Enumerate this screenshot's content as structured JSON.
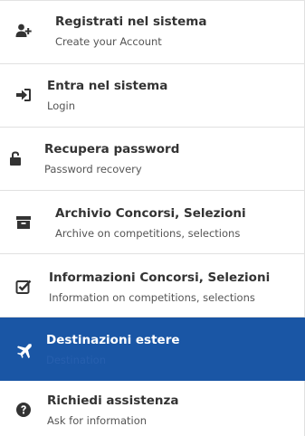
{
  "menu": {
    "items": [
      {
        "title": "Registrati nel sistema",
        "subtitle": "Create your Account",
        "icon": "user-plus-icon",
        "active": false
      },
      {
        "title": "Entra nel sistema",
        "subtitle": "Login",
        "icon": "sign-in-icon",
        "active": false
      },
      {
        "title": "Recupera password",
        "subtitle": "Password recovery",
        "icon": "unlock-icon",
        "active": false
      },
      {
        "title": "Archivio Concorsi, Selezioni",
        "subtitle": "Archive on competitions, selections",
        "icon": "archive-icon",
        "active": false
      },
      {
        "title": "Informazioni Concorsi, Selezioni",
        "subtitle": "Information on competitions, selections",
        "icon": "check-square-icon",
        "active": false
      },
      {
        "title": "Destinazioni estere",
        "subtitle": "Destination",
        "icon": "plane-icon",
        "active": true
      },
      {
        "title": "Richiedi assistenza",
        "subtitle": "Ask for information",
        "icon": "question-circle-icon",
        "active": false
      }
    ]
  },
  "colors": {
    "active_background": "#1a56a5",
    "text": "#333333",
    "subtext": "#555555",
    "divider": "#e1e1e1"
  }
}
